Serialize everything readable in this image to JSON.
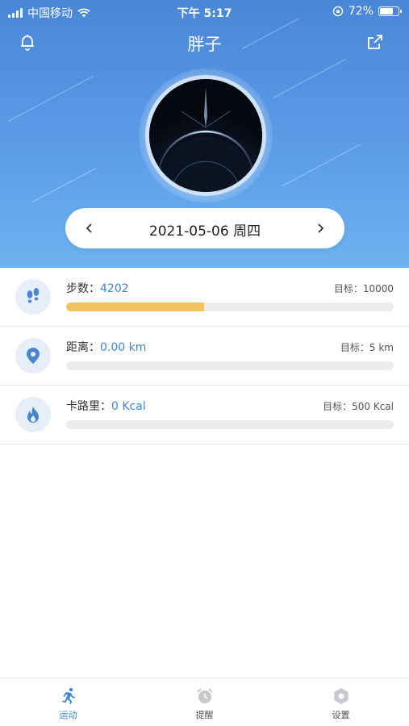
{
  "status_bar": {
    "carrier": "中国移动",
    "time": "下午 5:17",
    "battery": "72%",
    "battery_level": 0.72
  },
  "header": {
    "title": "胖子",
    "left_icon": "bell-icon",
    "right_icon": "share-icon"
  },
  "date_selector": {
    "prev_icon": "chevron-left",
    "date": "2021-05-06 周四",
    "next_icon": "chevron-right"
  },
  "stats": [
    {
      "icon": "footprints-icon",
      "label": "步数：",
      "value": "4202",
      "goal": "目标：10000",
      "progress": 0.42
    },
    {
      "icon": "location-pin-icon",
      "label": "距离：",
      "value": "0.00 km",
      "goal": "目标：5 km",
      "progress": 0
    },
    {
      "icon": "flame-icon",
      "label": "卡路里：",
      "value": "0 Kcal",
      "goal": "目标：500 Kcal",
      "progress": 0
    }
  ],
  "tabs": [
    {
      "label": "运动",
      "icon": "running-icon",
      "active": true
    },
    {
      "label": "提醒",
      "icon": "alarm-clock-icon",
      "active": false
    },
    {
      "label": "设置",
      "icon": "gear-icon",
      "active": false
    }
  ],
  "colors": {
    "accent": "#3f86d6",
    "progress": "#f0c260",
    "header_top": "#4a86d8",
    "header_bottom": "#6cb3f0"
  }
}
